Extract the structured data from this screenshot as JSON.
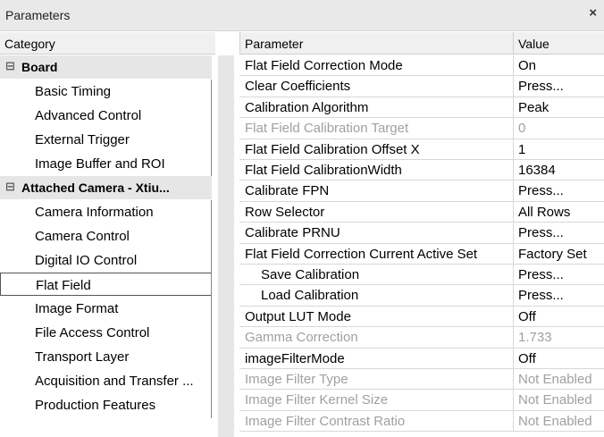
{
  "window": {
    "title": "Parameters",
    "close_glyph": "×"
  },
  "headers": {
    "category": "Category",
    "parameter": "Parameter",
    "value": "Value"
  },
  "tree_glyph": "⊟",
  "categories": [
    {
      "label": "Board",
      "group": true
    },
    {
      "label": "Basic Timing"
    },
    {
      "label": "Advanced Control"
    },
    {
      "label": "External Trigger"
    },
    {
      "label": "Image Buffer and ROI"
    },
    {
      "label": "Attached Camera - Xtiu...",
      "group": true
    },
    {
      "label": "Camera Information"
    },
    {
      "label": "Camera Control"
    },
    {
      "label": "Digital IO Control"
    },
    {
      "label": "Flat Field",
      "selected": true
    },
    {
      "label": "Image Format"
    },
    {
      "label": "File Access Control"
    },
    {
      "label": "Transport Layer"
    },
    {
      "label": "Acquisition and Transfer ..."
    },
    {
      "label": "Production Features"
    }
  ],
  "parameters": [
    {
      "name": "Flat Field Correction Mode",
      "value": "On"
    },
    {
      "name": "Clear Coefficients",
      "value": "Press..."
    },
    {
      "name": "Calibration Algorithm",
      "value": "Peak"
    },
    {
      "name": "Flat Field Calibration Target",
      "value": "0",
      "disabled": true
    },
    {
      "name": "Flat Field Calibration Offset X",
      "value": "1"
    },
    {
      "name": "Flat Field CalibrationWidth",
      "value": "16384"
    },
    {
      "name": "Calibrate FPN",
      "value": "Press..."
    },
    {
      "name": "Row Selector",
      "value": "All Rows"
    },
    {
      "name": "Calibrate PRNU",
      "value": "Press..."
    },
    {
      "name": "Flat Field Correction Current Active Set",
      "value": "Factory Set"
    },
    {
      "name": "Save Calibration",
      "value": "Press...",
      "indent": true
    },
    {
      "name": "Load Calibration",
      "value": "Press...",
      "indent": true
    },
    {
      "name": "Output LUT Mode",
      "value": "Off"
    },
    {
      "name": "Gamma Correction",
      "value": "1.733",
      "disabled": true
    },
    {
      "name": "imageFilterMode",
      "value": "Off"
    },
    {
      "name": "Image Filter Type",
      "value": "Not Enabled",
      "disabled": true
    },
    {
      "name": "Image Filter Kernel Size",
      "value": "Not Enabled",
      "disabled": true
    },
    {
      "name": "Image Filter Contrast Ratio",
      "value": "Not Enabled",
      "disabled": true
    }
  ]
}
